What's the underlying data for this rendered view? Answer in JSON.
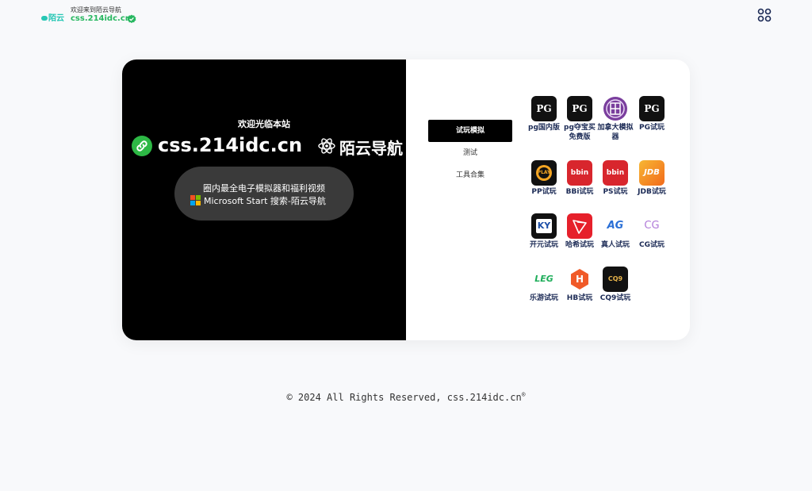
{
  "header": {
    "logo_text": "陌云",
    "welcome": "欢迎来到陌云导航",
    "site": "css.214idc.cn"
  },
  "hero": {
    "tagline": "欢迎光临本站",
    "domain": "css.214idc.cn",
    "brand": "陌云导航",
    "pill_line1": "圈内最全电子模拟器和福利视频",
    "pill_line2": "Microsoft Start 搜索-陌云导航"
  },
  "menu": [
    {
      "label": "试玩模拟",
      "active": true
    },
    {
      "label": "测试",
      "active": false
    },
    {
      "label": "工具合集",
      "active": false
    }
  ],
  "apps": [
    {
      "label": "pg国内版",
      "icon": "pg-logo-icon"
    },
    {
      "label": "pg夺宝买免费版",
      "icon": "pg-logo-icon"
    },
    {
      "label": "加拿大模拟器",
      "icon": "canada-seal-icon"
    },
    {
      "label": "PG试玩",
      "icon": "pg-logo-icon"
    },
    {
      "label": "PP试玩",
      "icon": "pp-play-icon"
    },
    {
      "label": "BBi试玩",
      "icon": "bbin-icon"
    },
    {
      "label": "PS试玩",
      "icon": "bbin-icon"
    },
    {
      "label": "JDB试玩",
      "icon": "jdb-icon"
    },
    {
      "label": "开元试玩",
      "icon": "ky-icon"
    },
    {
      "label": "哈希试玩",
      "icon": "tron-icon"
    },
    {
      "label": "真人试玩",
      "icon": "ag-icon"
    },
    {
      "label": "CG试玩",
      "icon": "cg-icon"
    },
    {
      "label": "乐游试玩",
      "icon": "leg-icon"
    },
    {
      "label": "HB试玩",
      "icon": "hb-icon"
    },
    {
      "label": "CQ9试玩",
      "icon": "cq9-icon"
    }
  ],
  "icon_text": {
    "pg": "PG",
    "pp": "PLAY",
    "bbin": "bbin",
    "jdb": "JDB",
    "ky": "KY",
    "ag": "AG",
    "cg": "CG",
    "leg": "LEG",
    "hb": "H",
    "cq9": "CQ9"
  },
  "footer": {
    "text": "© 2024 All Rights Reserved, css.214idc.cn",
    "mark": "®"
  },
  "colors": {
    "accent_green": "#27b760",
    "teal": "#27c7b5",
    "navy": "#1b2a55"
  }
}
